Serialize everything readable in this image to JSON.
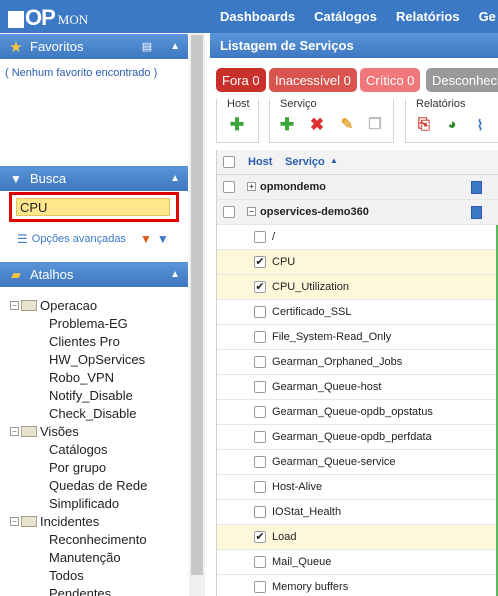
{
  "app": {
    "logo_op": "OP",
    "logo_mon": "MON"
  },
  "nav": [
    "Dashboards",
    "Catálogos",
    "Relatórios",
    "Ge"
  ],
  "favoritos": {
    "title": "Favoritos",
    "empty": "( Nenhum favorito encontrado )"
  },
  "busca": {
    "title": "Busca",
    "value": "CPU",
    "advanced": "Opções avançadas"
  },
  "atalhos": {
    "title": "Atalhos",
    "tree": [
      {
        "label": "Operacao",
        "level": 0
      },
      {
        "label": "Problema-EG",
        "level": 1
      },
      {
        "label": "Clientes Pro",
        "level": 1
      },
      {
        "label": "HW_OpServices",
        "level": 1
      },
      {
        "label": "Robo_VPN",
        "level": 1
      },
      {
        "label": "Notify_Disable",
        "level": 1
      },
      {
        "label": "Check_Disable",
        "level": 1
      },
      {
        "label": "Visões",
        "level": 0
      },
      {
        "label": "Catálogos",
        "level": 1
      },
      {
        "label": "Por grupo",
        "level": 1
      },
      {
        "label": "Quedas de Rede",
        "level": 1
      },
      {
        "label": "Simplificado",
        "level": 1
      },
      {
        "label": "Incidentes",
        "level": 0
      },
      {
        "label": "Reconhecimento",
        "level": 1
      },
      {
        "label": "Manutenção",
        "level": 1
      },
      {
        "label": "Todos",
        "level": 1
      },
      {
        "label": "Pendentes",
        "level": 1
      }
    ]
  },
  "main": {
    "title": "Listagem de Serviços",
    "badges": [
      {
        "label": "Fora 0",
        "color": "#c9302c"
      },
      {
        "label": "Inacessível 0",
        "color": "#d9534f"
      },
      {
        "label": "Crítico 0",
        "color": "#f0787a"
      },
      {
        "label": "Desconheci",
        "color": "#9a9a9a"
      }
    ],
    "toolbar": {
      "host": "Host",
      "servico": "Serviço",
      "relatorios": "Relatórios"
    },
    "grid": {
      "col_host": "Host",
      "col_servico": "Serviço",
      "sort_icon": "▲",
      "rows": [
        {
          "type": "group",
          "label": "opmondemo",
          "toggle": "+",
          "checked": false
        },
        {
          "type": "group",
          "label": "opservices-demo360",
          "toggle": "−",
          "checked": false
        },
        {
          "type": "service",
          "label": "/",
          "checked": false
        },
        {
          "type": "service",
          "label": "CPU",
          "checked": true
        },
        {
          "type": "service",
          "label": "CPU_Utilization",
          "checked": true
        },
        {
          "type": "service",
          "label": "Certificado_SSL",
          "checked": false
        },
        {
          "type": "service",
          "label": "File_System-Read_Only",
          "checked": false
        },
        {
          "type": "service",
          "label": "Gearman_Orphaned_Jobs",
          "checked": false
        },
        {
          "type": "service",
          "label": "Gearman_Queue-host",
          "checked": false
        },
        {
          "type": "service",
          "label": "Gearman_Queue-opdb_opstatus",
          "checked": false
        },
        {
          "type": "service",
          "label": "Gearman_Queue-opdb_perfdata",
          "checked": false
        },
        {
          "type": "service",
          "label": "Gearman_Queue-service",
          "checked": false
        },
        {
          "type": "service",
          "label": "Host-Alive",
          "checked": false
        },
        {
          "type": "service",
          "label": "IOStat_Health",
          "checked": false
        },
        {
          "type": "service",
          "label": "Load",
          "checked": true
        },
        {
          "type": "service",
          "label": "Mail_Queue",
          "checked": false
        },
        {
          "type": "service",
          "label": "Memory buffers",
          "checked": false
        }
      ]
    }
  }
}
